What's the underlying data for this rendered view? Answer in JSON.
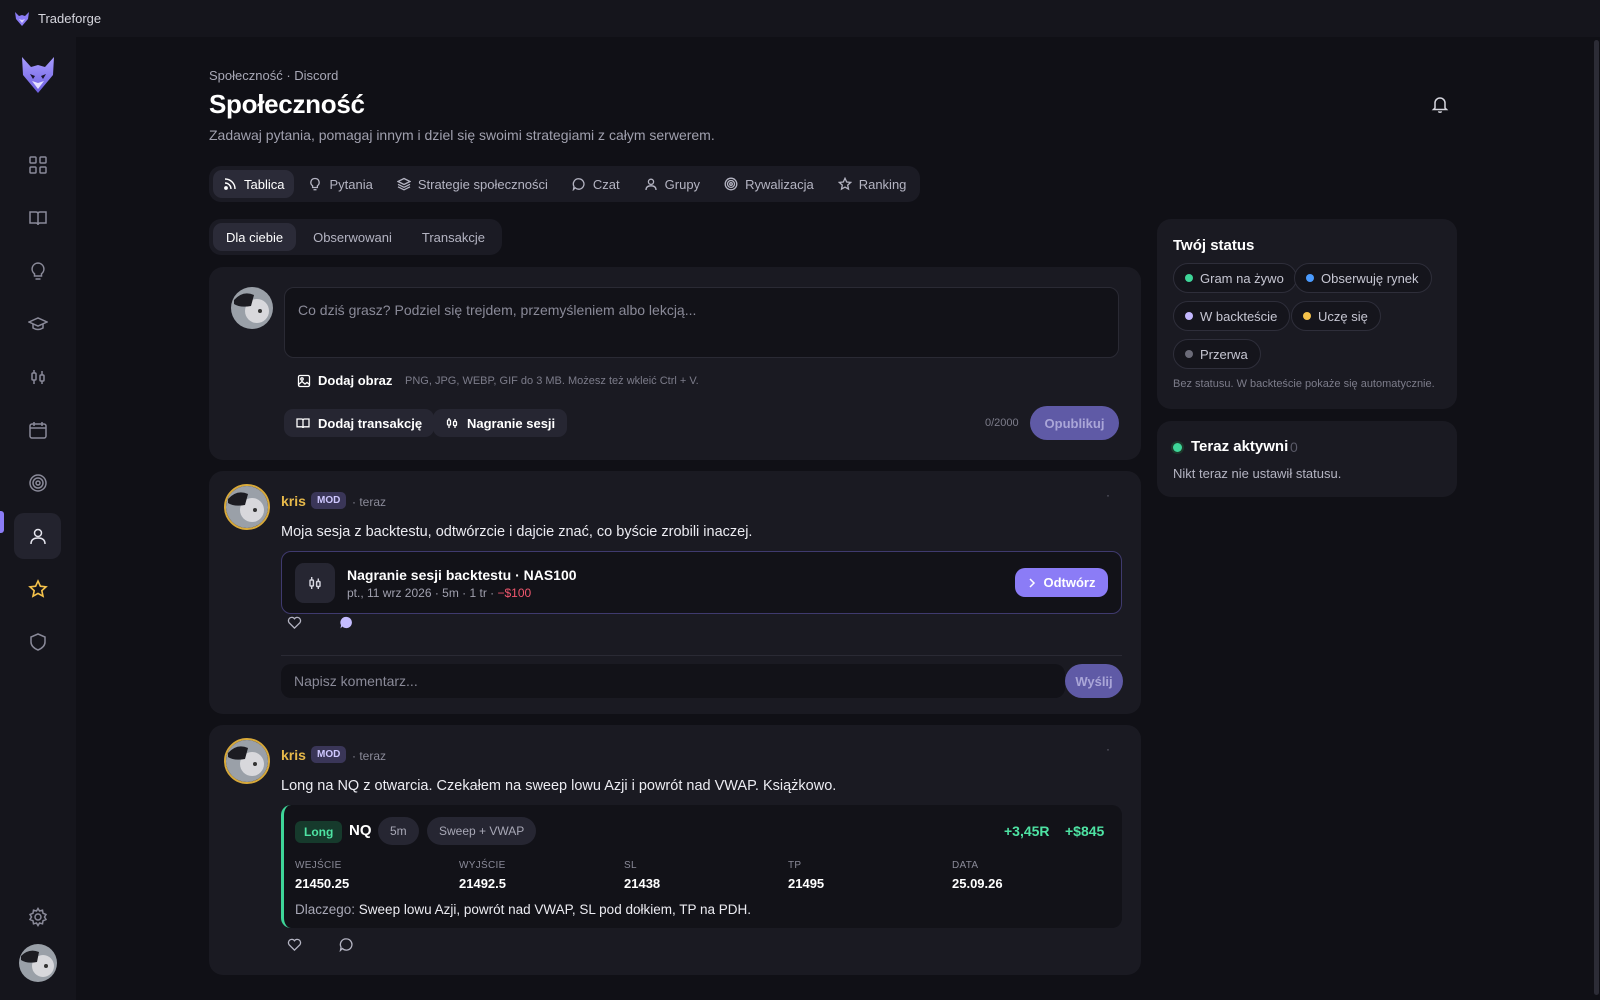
{
  "window": {
    "title": "Tradeforge"
  },
  "header": {
    "breadcrumb": "Społeczność · Discord",
    "title": "Społeczność",
    "subtitle": "Zadawaj pytania, pomagaj innym i dziel się swoimi strategiami z całym serwerem."
  },
  "tabs": [
    {
      "label": "Tablica",
      "icon": "rss-icon",
      "active": true
    },
    {
      "label": "Pytania",
      "icon": "lightbulb-icon"
    },
    {
      "label": "Strategie społeczności",
      "icon": "layers-icon"
    },
    {
      "label": "Czat",
      "icon": "chat-icon"
    },
    {
      "label": "Grupy",
      "icon": "user-icon"
    },
    {
      "label": "Rywalizacja",
      "icon": "target-icon"
    },
    {
      "label": "Ranking",
      "icon": "star-icon"
    }
  ],
  "subtabs": [
    {
      "label": "Dla ciebie",
      "active": true
    },
    {
      "label": "Obserwowani"
    },
    {
      "label": "Transakcje"
    }
  ],
  "composer": {
    "placeholder": "Co dziś grasz? Podziel się trejdem, przemyśleniem albo lekcją...",
    "add_image": "Dodaj obraz",
    "image_hint": "PNG, JPG, WEBP, GIF do 3 MB. Możesz też wkleić Ctrl + V.",
    "add_trade": "Dodaj transakcję",
    "session_recording": "Nagranie sesji",
    "counter": "0/2000",
    "publish": "Opublikuj"
  },
  "posts": [
    {
      "author": "kris",
      "badge": "MOD",
      "time": "· teraz",
      "more": "·",
      "text": "Moja sesja z backtestu, odtwórzcie i dajcie znać, co byście zrobili inaczej.",
      "session": {
        "title": "Nagranie sesji backtestu · NAS100",
        "meta": "pt., 11 wrz 2026 · 5m · 1 tr · ",
        "pnl": "−$100",
        "open_label": "Odtwórz"
      },
      "comment_placeholder": "Napisz komentarz...",
      "send_label": "Wyślij"
    },
    {
      "author": "kris",
      "badge": "MOD",
      "time": "· teraz",
      "more": "·",
      "text": "Long na NQ z otwarcia. Czekałem na sweep lowu Azji i powrót nad VWAP. Książkowo.",
      "trade": {
        "direction": "Long",
        "symbol": "NQ",
        "timeframe": "5m",
        "setup": "Sweep + VWAP",
        "r_multiple": "+3,45R",
        "pnl": "+$845",
        "fields": [
          {
            "label": "WEJŚCIE",
            "value": "21450.25"
          },
          {
            "label": "WYJŚCIE",
            "value": "21492.5"
          },
          {
            "label": "SL",
            "value": "21438"
          },
          {
            "label": "TP",
            "value": "21495"
          },
          {
            "label": "DATA",
            "value": "25.09.26"
          }
        ],
        "why_label": "Dlaczego:",
        "why_text": " Sweep lowu Azji, powrót nad VWAP, SL pod dołkiem, TP na PDH."
      }
    }
  ],
  "status_panel": {
    "title": "Twój status",
    "options": [
      {
        "label": "Gram na żywo",
        "color": "#3ed598"
      },
      {
        "label": "Obserwuję rynek",
        "color": "#4a9bff"
      },
      {
        "label": "W backteście",
        "color": "#c4b8ff"
      },
      {
        "label": "Uczę się",
        "color": "#f5c24b"
      },
      {
        "label": "Przerwa",
        "color": "#6b6b78"
      }
    ],
    "note": "Bez statusu. W backteście pokaże się automatycznie."
  },
  "active_panel": {
    "title": "Teraz aktywni",
    "count": "0",
    "note": "Nikt teraz nie ustawił statusu."
  },
  "colors": {
    "accent": "#8b7cf6",
    "positive": "#4ee3a3",
    "negative": "#f0576e",
    "mod_author": "#e7b94a"
  }
}
